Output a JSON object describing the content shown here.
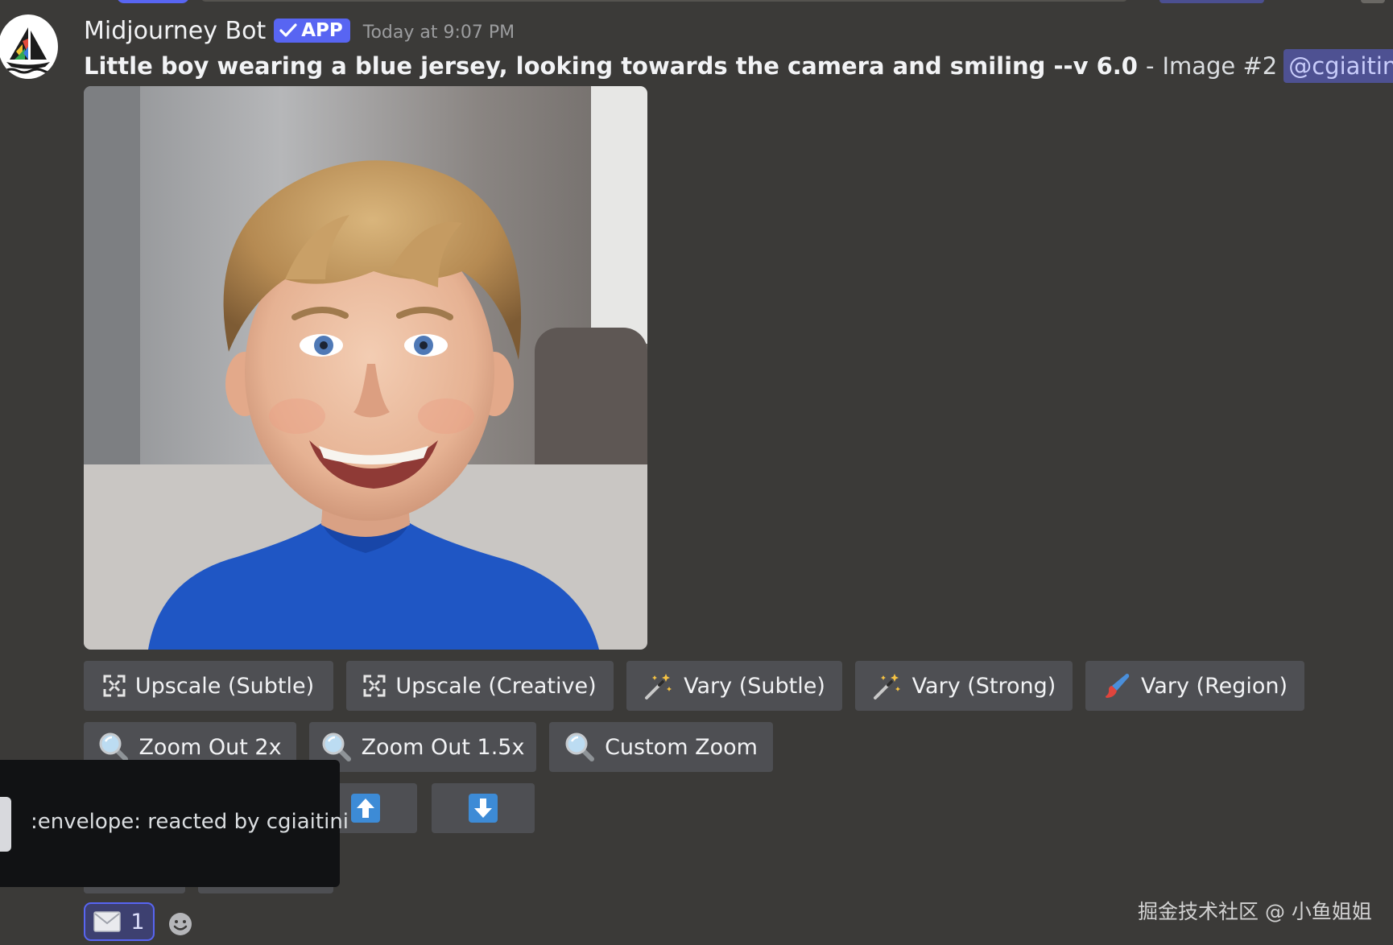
{
  "message": {
    "author": "Midjourney Bot",
    "badge_label": "APP",
    "timestamp": "Today at 9:07 PM",
    "prompt_bold": "Little boy wearing a blue jersey, looking towards the camera and smiling --v 6.0",
    "separator": "-",
    "image_label": "Image #2",
    "mention": "@cgiaitini"
  },
  "buttons": {
    "row1": [
      {
        "label": "Upscale (Subtle)",
        "icon": "upscale-icon"
      },
      {
        "label": "Upscale (Creative)",
        "icon": "upscale-icon"
      },
      {
        "label": "Vary (Subtle)",
        "icon": "magic-wand-icon"
      },
      {
        "label": "Vary (Strong)",
        "icon": "magic-wand-icon"
      },
      {
        "label": "Vary (Region)",
        "icon": "paintbrush-icon"
      }
    ],
    "row2": [
      {
        "label": "Zoom Out 2x",
        "icon": "magnifier-icon"
      },
      {
        "label": "Zoom Out 1.5x",
        "icon": "magnifier-icon"
      },
      {
        "label": "Custom Zoom",
        "icon": "magnifier-icon"
      }
    ],
    "row3": [
      {
        "label": "",
        "icon": "arrow-up-icon"
      },
      {
        "label": "",
        "icon": "arrow-down-icon"
      }
    ]
  },
  "tooltip": {
    "text": ":envelope: reacted by cgiaitini"
  },
  "reaction": {
    "emoji": "envelope-icon",
    "count": "1"
  },
  "watermark": "掘金技术社区 @ 小鱼姐姐",
  "colors": {
    "background": "#3b3a38",
    "button": "#4e4f53",
    "blurple": "#5865f2",
    "mention_bg": "#4e5192",
    "tooltip_bg": "#111214"
  }
}
